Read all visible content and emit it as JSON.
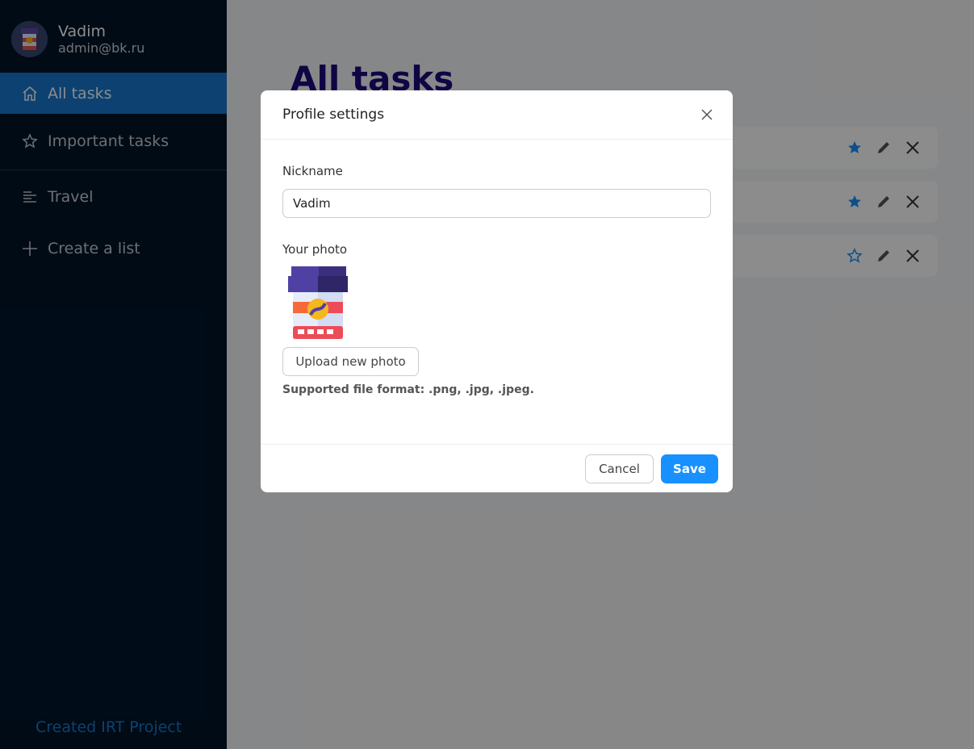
{
  "user": {
    "name": "Vadim",
    "email": "admin@bk.ru"
  },
  "sidebar": {
    "items": [
      {
        "label": "All tasks",
        "icon": "home-icon",
        "active": true
      },
      {
        "label": "Important tasks",
        "icon": "star-icon"
      },
      {
        "label": "Travel",
        "icon": "list-icon"
      },
      {
        "label": "Create a list",
        "icon": "plus-icon"
      }
    ],
    "footer": "Created IRT Project"
  },
  "main": {
    "title": "All tasks",
    "tasks": [
      {
        "important": true
      },
      {
        "important": true
      },
      {
        "important": false
      }
    ]
  },
  "modal": {
    "title": "Profile settings",
    "nickname_label": "Nickname",
    "nickname_value": "Vadim",
    "photo_label": "Your photo",
    "upload_label": "Upload new photo",
    "format_note": "Supported file format: .png, .jpg, .jpeg.",
    "cancel_label": "Cancel",
    "save_label": "Save"
  },
  "colors": {
    "sidebar_bg": "#001529",
    "active_item": "#1677d0",
    "title": "#1e0a7a",
    "primary": "#1890ff"
  }
}
